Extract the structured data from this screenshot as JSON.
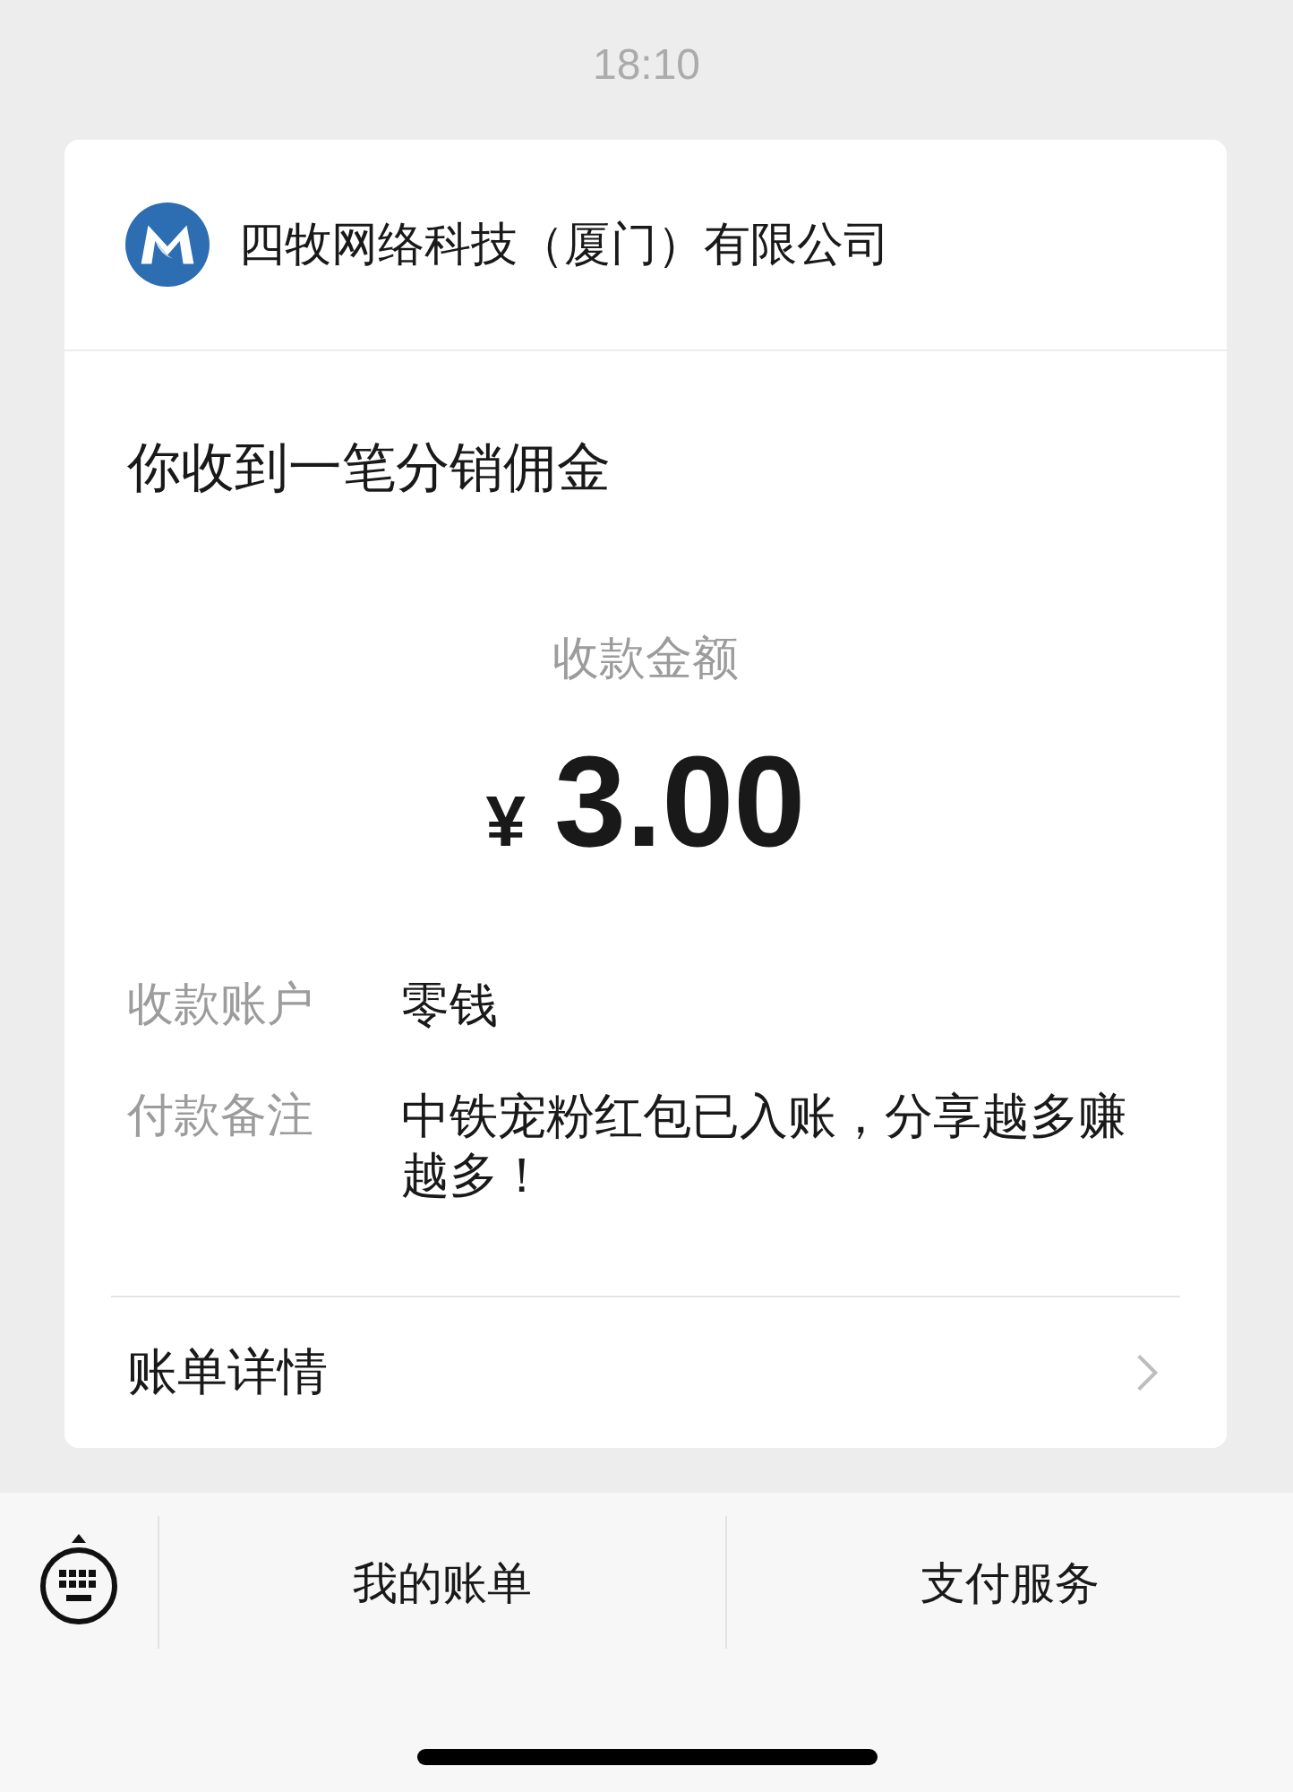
{
  "status_bar": {
    "time": "18:10"
  },
  "card": {
    "merchant": {
      "name": "四牧网络科技（厦门）有限公司"
    },
    "title": "你收到一笔分销佣金",
    "amount": {
      "label": "收款金额",
      "currency": "¥",
      "value": "3.00"
    },
    "details": [
      {
        "label": "收款账户",
        "value": "零钱"
      },
      {
        "label": "付款备注",
        "value": "中铁宠粉红包已入账，分享越多赚越多！"
      }
    ],
    "link": {
      "label": "账单详情"
    }
  },
  "bottom_menu": {
    "items": [
      {
        "label": "我的账单"
      },
      {
        "label": "支付服务"
      }
    ]
  }
}
